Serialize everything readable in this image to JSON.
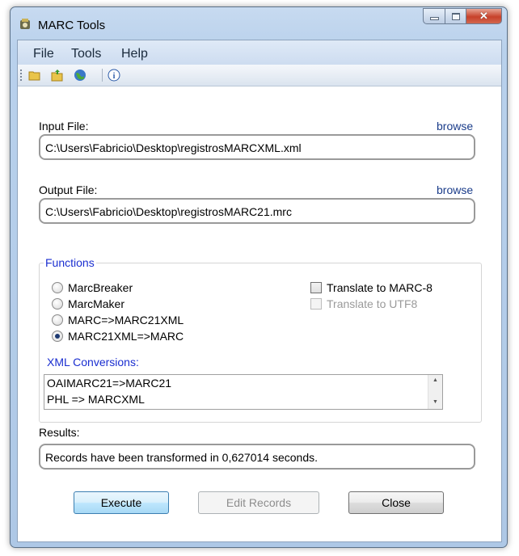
{
  "window": {
    "title": "MARC Tools",
    "icon": "marc-tools-app-icon"
  },
  "window_controls": [
    "minimize",
    "maximize",
    "close"
  ],
  "menu": [
    {
      "label": "File"
    },
    {
      "label": "Tools"
    },
    {
      "label": "Help"
    }
  ],
  "toolbar": [
    {
      "icon": "open-folder-icon",
      "tooltip": "Open"
    },
    {
      "icon": "export-folder-icon",
      "tooltip": "Save"
    },
    {
      "icon": "globe-icon",
      "tooltip": "Web"
    },
    {
      "icon": "info-icon",
      "tooltip": "About"
    }
  ],
  "input": {
    "label": "Input File:",
    "browse": "browse",
    "value": "C:\\Users\\Fabricio\\Desktop\\registrosMARCXML.xml"
  },
  "output": {
    "label": "Output File:",
    "browse": "browse",
    "value": "C:\\Users\\Fabricio\\Desktop\\registrosMARC21.mrc"
  },
  "functions": {
    "title": "Functions",
    "options": [
      {
        "label": "MarcBreaker",
        "selected": false
      },
      {
        "label": "MarcMaker",
        "selected": false
      },
      {
        "label": "MARC=>MARC21XML",
        "selected": false
      },
      {
        "label": "MARC21XML=>MARC",
        "selected": true
      }
    ],
    "checks": [
      {
        "label": "Translate to MARC-8",
        "checked": false,
        "enabled": true
      },
      {
        "label": "Translate to UTF8",
        "checked": false,
        "enabled": false
      }
    ],
    "xml_label": "XML Conversions:",
    "xml_items": [
      "OAIMARC21=>MARC21",
      "PHL => MARCXML"
    ]
  },
  "results": {
    "label": "Results:",
    "value": "Records have been transformed in 0,627014 seconds."
  },
  "buttons": {
    "execute": "Execute",
    "edit": "Edit Records",
    "close": "Close"
  },
  "colors": {
    "group_title": "#1a2ed0",
    "link": "#1a3c8a",
    "close_btn": "#c7412a"
  }
}
